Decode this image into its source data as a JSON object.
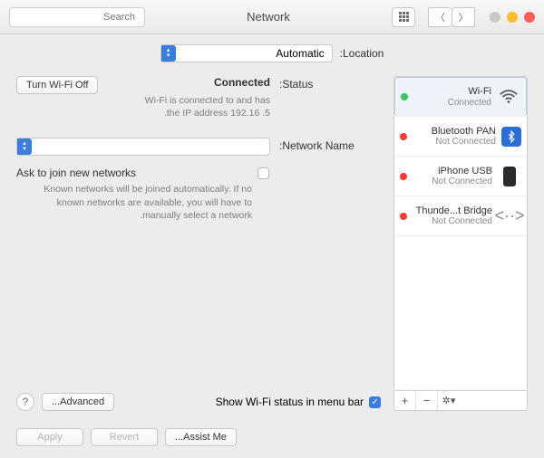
{
  "window": {
    "title": "Network"
  },
  "search": {
    "placeholder": "Search"
  },
  "location": {
    "label": "Location:",
    "value": "Automatic"
  },
  "services": [
    {
      "name": "Wi-Fi",
      "status": "Connected",
      "color": "green",
      "icon": "wifi"
    },
    {
      "name": "Bluetooth PAN",
      "status": "Not Connected",
      "color": "red",
      "icon": "bluetooth"
    },
    {
      "name": "iPhone USB",
      "status": "Not Connected",
      "color": "red",
      "icon": "iphone"
    },
    {
      "name": "Thunde...t Bridge",
      "status": "Not Connected",
      "color": "red",
      "icon": "thunderbolt"
    }
  ],
  "status": {
    "label": "Status:",
    "value": "Connected",
    "turn_off": "Turn Wi-Fi Off",
    "desc1": "Wi-Fi is connected to                     and has",
    "desc2": "the IP address 192.16            .5."
  },
  "network_name": {
    "label": "Network Name:",
    "value": ""
  },
  "ask_join": {
    "label": "Ask to join new networks",
    "note": "Known networks will be joined automatically. If no known networks are available, you will have to manually select a network."
  },
  "show_status": {
    "label": "Show Wi-Fi status in menu bar"
  },
  "buttons": {
    "advanced": "Advanced...",
    "assist": "Assist Me...",
    "revert": "Revert",
    "apply": "Apply"
  },
  "sidetools": {
    "add": "+",
    "remove": "−",
    "gear": "✻▾"
  }
}
